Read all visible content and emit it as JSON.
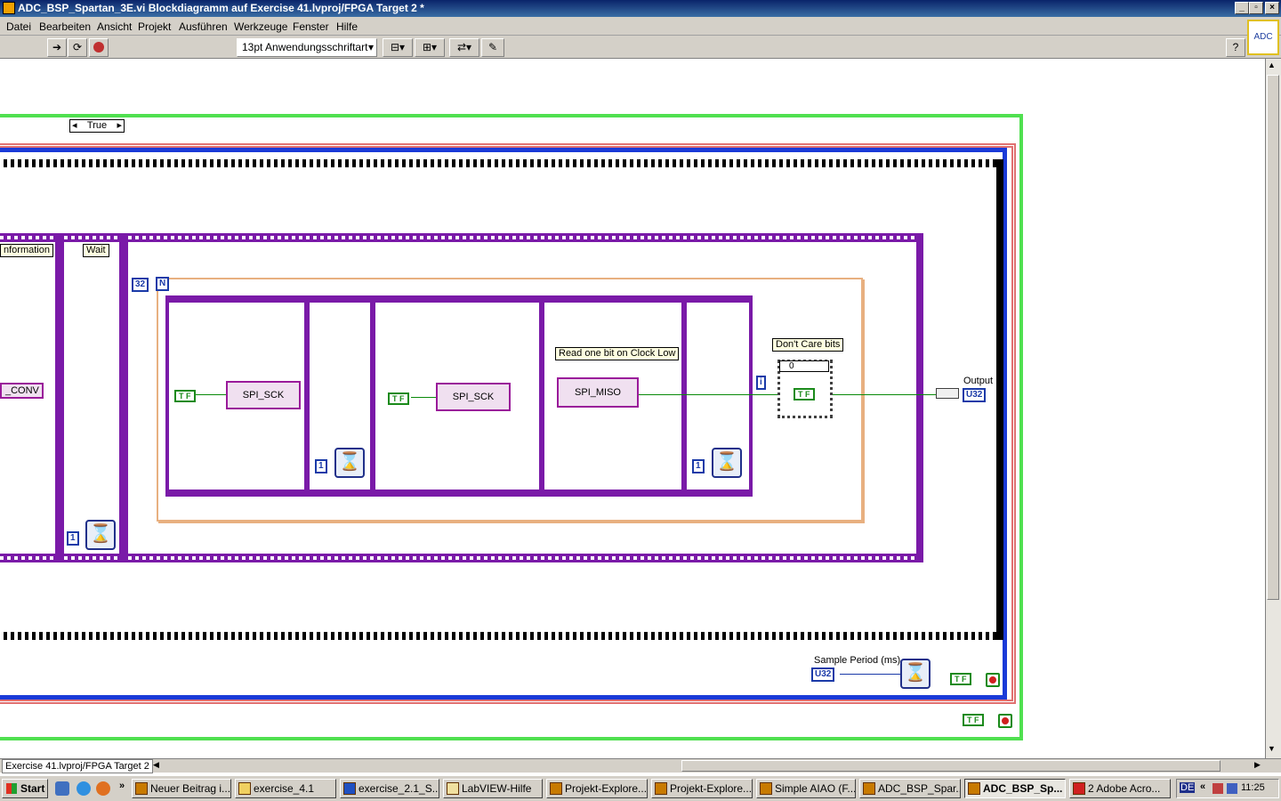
{
  "window": {
    "title": "ADC_BSP_Spartan_3E.vi Blockdiagramm auf Exercise 41.lvproj/FPGA Target 2 *"
  },
  "menu": [
    {
      "label": "Datei"
    },
    {
      "label": "Bearbeiten"
    },
    {
      "label": "Ansicht"
    },
    {
      "label": "Projekt"
    },
    {
      "label": "Ausführen"
    },
    {
      "label": "Werkzeuge"
    },
    {
      "label": "Fenster"
    },
    {
      "label": "Hilfe"
    }
  ],
  "toolbar": {
    "font_select": "13pt Anwendungsschriftart",
    "help": "?",
    "vi_icon": "ADC"
  },
  "diagram": {
    "case_selector": "True",
    "labels": {
      "information": "nformation",
      "wait": "Wait",
      "read_one_bit": "Read one bit on Clock Low",
      "dont_care": "Don't Care bits",
      "output": "Output",
      "sample_period": "Sample Period (ms)"
    },
    "constants": {
      "loop_count": "32",
      "loop_n": "N",
      "loop_i": "i",
      "wait1": "1",
      "wait2": "1",
      "wait3": "1",
      "case_zero": "0",
      "u32": "U32",
      "u32_control": "U32"
    },
    "bools": {
      "true1": "T F",
      "false1": "T F",
      "true_case": "T F",
      "false_bottom1": "T F",
      "false_bottom2": "T F"
    },
    "io_nodes": {
      "conv": "_CONV",
      "sck1": "SPI_SCK",
      "sck2": "SPI_SCK",
      "miso": "SPI_MISO"
    }
  },
  "statusbar": {
    "project": "Exercise 41.lvproj/FPGA Target 2"
  },
  "taskbar": {
    "start": "Start",
    "time": "11:25",
    "lang": "DE",
    "tasks": [
      {
        "label": "Neuer Beitrag i..."
      },
      {
        "label": "exercise_4.1"
      },
      {
        "label": "exercise_2.1_S..."
      },
      {
        "label": "LabVIEW-Hilfe"
      },
      {
        "label": "Projekt-Explore..."
      },
      {
        "label": "Projekt-Explore..."
      },
      {
        "label": "Simple AIAO (F..."
      },
      {
        "label": "ADC_BSP_Spar..."
      },
      {
        "label": "ADC_BSP_Sp...",
        "active": true
      },
      {
        "label": "2 Adobe Acro..."
      }
    ]
  }
}
